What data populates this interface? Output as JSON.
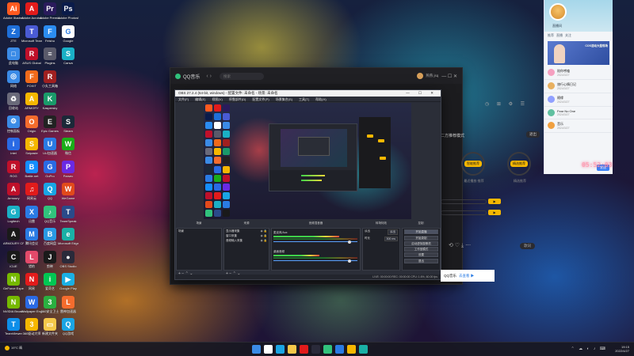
{
  "desktop": {
    "icons": [
      {
        "label": "Adobe Illustrator",
        "color": "#ff5a1f",
        "glyph": "Ai",
        "col": 0,
        "row": 0
      },
      {
        "label": "Adobe Acrobat",
        "color": "#e21b1b",
        "glyph": "A",
        "col": 1,
        "row": 0
      },
      {
        "label": "Adobe Premiere",
        "color": "#2a1b5c",
        "glyph": "Pr",
        "col": 2,
        "row": 0
      },
      {
        "label": "Adobe Photoshop",
        "color": "#0a1b4a",
        "glyph": "Ps",
        "col": 3,
        "row": 0
      },
      {
        "label": "ZTE",
        "color": "#1e6fd9",
        "glyph": "Z",
        "col": 0,
        "row": 1
      },
      {
        "label": "Microsoft Teams",
        "color": "#4a5bd4",
        "glyph": "T",
        "col": 1,
        "row": 1
      },
      {
        "label": "Feishu",
        "color": "#2b8cf0",
        "glyph": "F",
        "col": 2,
        "row": 1
      },
      {
        "label": "Google",
        "color": "#ffffff",
        "glyph": "G",
        "col": 3,
        "row": 1
      },
      {
        "label": "此电脑",
        "color": "#3b8be6",
        "glyph": "□",
        "col": 0,
        "row": 2
      },
      {
        "label": "ASUS Global",
        "color": "#c0102a",
        "glyph": "R",
        "col": 1,
        "row": 2
      },
      {
        "label": "Plugins",
        "color": "#5a5a6a",
        "glyph": "≡",
        "col": 2,
        "row": 2
      },
      {
        "label": "Canva",
        "color": "#1ab0c6",
        "glyph": "S",
        "col": 3,
        "row": 2
      },
      {
        "label": "网络",
        "color": "#3b8be6",
        "glyph": "◎",
        "col": 0,
        "row": 3
      },
      {
        "label": "FOXIT",
        "color": "#f06a1a",
        "glyph": "F",
        "col": 1,
        "row": 3
      },
      {
        "label": "小丸工具箱",
        "color": "#a02020",
        "glyph": "R",
        "col": 2,
        "row": 3
      },
      {
        "label": "回收站",
        "color": "#6a6a7a",
        "glyph": "♻",
        "col": 0,
        "row": 4
      },
      {
        "label": "ARMORY",
        "color": "#f5b700",
        "glyph": "A",
        "col": 1,
        "row": 4
      },
      {
        "label": "Kaspersky",
        "color": "#1a9a6a",
        "glyph": "K",
        "col": 2,
        "row": 4
      },
      {
        "label": "控制面板",
        "color": "#3b8be6",
        "glyph": "⚙",
        "col": 0,
        "row": 5
      },
      {
        "label": "Origin",
        "color": "#f56c2d",
        "glyph": "O",
        "col": 1,
        "row": 5
      },
      {
        "label": "Epic Games",
        "color": "#222222",
        "glyph": "E",
        "col": 2,
        "row": 5
      },
      {
        "label": "Steam",
        "color": "#1b2838",
        "glyph": "S",
        "col": 3,
        "row": 5
      },
      {
        "label": "Intel",
        "color": "#2a6ae4",
        "glyph": "i",
        "col": 0,
        "row": 6
      },
      {
        "label": "Snipaste",
        "color": "#f5b700",
        "glyph": "S",
        "col": 1,
        "row": 6
      },
      {
        "label": "UU加速器",
        "color": "#2a7be4",
        "glyph": "U",
        "col": 2,
        "row": 6
      },
      {
        "label": "微信",
        "color": "#1aad19",
        "glyph": "W",
        "col": 3,
        "row": 6
      },
      {
        "label": "ROG",
        "color": "#c0102a",
        "glyph": "R",
        "col": 0,
        "row": 7
      },
      {
        "label": "Battle.net",
        "color": "#148eff",
        "glyph": "B",
        "col": 1,
        "row": 7
      },
      {
        "label": "GoPro",
        "color": "#2a6ae4",
        "glyph": "G",
        "col": 2,
        "row": 7
      },
      {
        "label": "Parsec",
        "color": "#6a2ae4",
        "glyph": "P",
        "col": 3,
        "row": 7
      },
      {
        "label": "Armoury",
        "color": "#c0102a",
        "glyph": "A",
        "col": 0,
        "row": 8
      },
      {
        "label": "网易云",
        "color": "#e21b1b",
        "glyph": "♫",
        "col": 1,
        "row": 8
      },
      {
        "label": "QQ",
        "color": "#1aa5e4",
        "glyph": "Q",
        "col": 2,
        "row": 8
      },
      {
        "label": "WeGame",
        "color": "#e24a1b",
        "glyph": "W",
        "col": 3,
        "row": 8
      },
      {
        "label": "Logitech",
        "color": "#1ab0c6",
        "glyph": "G",
        "col": 0,
        "row": 9
      },
      {
        "label": "迅雷",
        "color": "#2a7be4",
        "glyph": "X",
        "col": 1,
        "row": 9
      },
      {
        "label": "QQ音乐",
        "color": "#31c27c",
        "glyph": "♪",
        "col": 2,
        "row": 9
      },
      {
        "label": "TeamSpeak",
        "color": "#2a4a8a",
        "glyph": "T",
        "col": 3,
        "row": 9
      },
      {
        "label": "ARMOURY CRATE",
        "color": "#1a1a1a",
        "glyph": "A",
        "col": 0,
        "row": 10
      },
      {
        "label": "腾讯会议",
        "color": "#2a7be4",
        "glyph": "M",
        "col": 1,
        "row": 10
      },
      {
        "label": "百度网盘",
        "color": "#2a9ae4",
        "glyph": "B",
        "col": 2,
        "row": 10
      },
      {
        "label": "Microsoft Edge",
        "color": "#1ab0a6",
        "glyph": "e",
        "col": 3,
        "row": 10
      },
      {
        "label": "iCUE",
        "color": "#1a1a1a",
        "glyph": "C",
        "col": 0,
        "row": 11
      },
      {
        "label": "猎豹",
        "color": "#e24a6a",
        "glyph": "L",
        "col": 1,
        "row": 11
      },
      {
        "label": "剪映",
        "color": "#1a1a1a",
        "glyph": "J",
        "col": 2,
        "row": 11
      },
      {
        "label": "OBS Studio",
        "color": "#2a2a3a",
        "glyph": "●",
        "col": 3,
        "row": 11
      },
      {
        "label": "GeForce Experience",
        "color": "#76b900",
        "glyph": "N",
        "col": 0,
        "row": 12
      },
      {
        "label": "网易",
        "color": "#e21b1b",
        "glyph": "N",
        "col": 1,
        "row": 12
      },
      {
        "label": "爱奇艺",
        "color": "#00c853",
        "glyph": "i",
        "col": 2,
        "row": 12
      },
      {
        "label": "Google Play",
        "color": "#1ab0e4",
        "glyph": "▶",
        "col": 3,
        "row": 12
      },
      {
        "label": "NVIDIA Broadcast",
        "color": "#76b900",
        "glyph": "N",
        "col": 0,
        "row": 13
      },
      {
        "label": "Wallpaper Engine",
        "color": "#2a6ae4",
        "glyph": "W",
        "col": 1,
        "row": 13
      },
      {
        "label": "360安全卫士",
        "color": "#2ab040",
        "glyph": "3",
        "col": 2,
        "row": 13
      },
      {
        "label": "雷神加速器",
        "color": "#f56c2d",
        "glyph": "L",
        "col": 3,
        "row": 13
      },
      {
        "label": "TeamViewer",
        "color": "#0e8ee9",
        "glyph": "T",
        "col": 0,
        "row": 14
      },
      {
        "label": "360驱动大师",
        "color": "#f5b700",
        "glyph": "3",
        "col": 1,
        "row": 14
      },
      {
        "label": "新建文件夹",
        "color": "#f5c84a",
        "glyph": "▭",
        "col": 2,
        "row": 14
      },
      {
        "label": "QQ游戏",
        "color": "#1aa5e4",
        "glyph": "Q",
        "col": 3,
        "row": 14
      }
    ]
  },
  "qq_music": {
    "title": "QQ音乐",
    "nav": "‹ ›",
    "search_placeholder": "搜索",
    "user": "燕燕 jsq",
    "controls": "— ☐ ✕",
    "mode_label": "二方推荐模式",
    "mode_button": "退出",
    "left_pill": "智能推荐",
    "right_pill": "精选推荐",
    "left_sub": "最近播放·推荐",
    "right_sub": "精选推荐",
    "footer_icons": "⟲ ♡ ⤓ ⋯",
    "footer_pill": "歌词"
  },
  "obs": {
    "title": "OBS 27.2.4 (64-bit, windows) - 配置文件: 未命名 - 场景: 未命名",
    "window_controls": "— ☐ ✕",
    "menu": [
      "文件(F)",
      "编辑(E)",
      "视图(V)",
      "停靠部件(D)",
      "配置文件(P)",
      "场景集合(S)",
      "工具(T)",
      "帮助(H)"
    ],
    "docks": {
      "scenes_header": "场景",
      "sources_header": "来源",
      "mixer_header": "音频混音器",
      "transitions_header": "转场特效",
      "controls_header": "控制",
      "scenes": [
        "场景"
      ],
      "sources": [
        "显示器采集",
        "窗口采集",
        "音频输入采集"
      ],
      "mixer": [
        {
          "name": "麦克风/Aux",
          "level": 0.78,
          "active": true
        },
        {
          "name": "桌面音频",
          "level": 0.55,
          "active": true
        }
      ],
      "transition_rows": [
        {
          "label": "淡出",
          "value": "淡出"
        },
        {
          "label": "时长",
          "value": "300 ms"
        }
      ],
      "control_buttons": [
        "开始直播",
        "开始录制",
        "启动虚拟摄像机",
        "工作室模式",
        "设置",
        "退出"
      ],
      "tool_glyphs": "+ − ⌃ ⌄"
    },
    "status": "LIVE: 00:00:00  REC: 00:00:00  CPU: 1.6%, 60.00 fps"
  },
  "chat_panel": {
    "header_name": "直播间",
    "tabs": [
      "推荐",
      "直播",
      "关注"
    ],
    "video_caption": "COS活动大型现场",
    "items": [
      {
        "name": "陪你唠嗑",
        "sub": "2024/3/27",
        "color": "#f5a0c0"
      },
      {
        "name": "旅行心情日记",
        "sub": "2024/3/27",
        "color": "#e8b060"
      },
      {
        "name": "随缘",
        "sub": "2024/3/27",
        "color": "#90a0ff"
      },
      {
        "name": "Fear No One",
        "sub": "2024/3/27",
        "color": "#60c0a0"
      },
      {
        "name": "音乐",
        "sub": "2024/3/27",
        "color": "#f0a040"
      }
    ],
    "button": "发送"
  },
  "clock_widget": "05:52:03",
  "notify": {
    "text": "QQ音乐",
    "link": "去查看 ▶"
  },
  "taskbar": {
    "weather": "19°C 晴",
    "icon_colors": [
      "#3b8be6",
      "#ffffff",
      "#1aa5e4",
      "#f5c84a",
      "#e21b1b",
      "#2a2a3a",
      "#31c27c",
      "#2a7be4",
      "#f5b700",
      "#1ab0a6"
    ],
    "sys_icons": "⌃ ☁ ◐ ♪ ⌨",
    "time": "19:15",
    "date": "2022/4/27"
  }
}
